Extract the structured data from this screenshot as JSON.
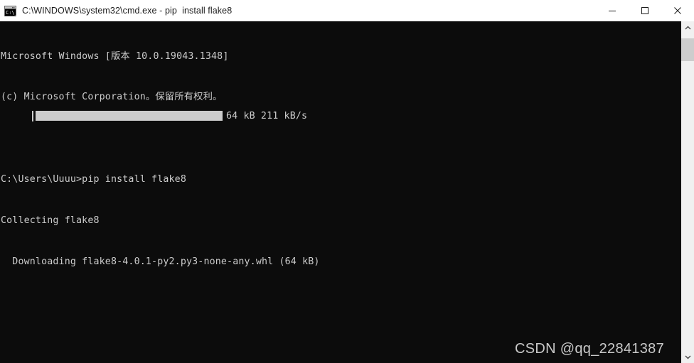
{
  "window": {
    "title": "C:\\WINDOWS\\system32\\cmd.exe - pip  install flake8",
    "icon": "cmd-console-icon",
    "titlebar_bg": "#ffffff",
    "titlebar_fg": "#1b1b1b",
    "controls": {
      "minimize_label": "Minimize",
      "maximize_label": "Maximize",
      "close_label": "Close"
    }
  },
  "console": {
    "background": "#0c0c0c",
    "foreground": "#cccccc",
    "lines": [
      "Microsoft Windows [版本 10.0.19043.1348]",
      "(c) Microsoft Corporation。保留所有权利。",
      "",
      "C:\\Users\\Uuuu>pip install flake8",
      "Collecting flake8",
      "  Downloading flake8-4.0.1-py2.py3-none-any.whl (64 kB)"
    ],
    "progress": {
      "bracket": "│",
      "fill_color": "#cccccc",
      "percent": 100,
      "downloaded": "64 kB",
      "speed": "211 kB/s",
      "stats_text": "64 kB 211 kB/s"
    }
  },
  "scrollbar": {
    "up_arrow": "scroll-up-icon",
    "down_arrow": "scroll-down-icon",
    "thumb_color": "#cdcdcd",
    "track_color": "#f0f0f0"
  },
  "watermark": {
    "text": "CSDN @qq_22841387",
    "color": "#c9c9c9"
  }
}
